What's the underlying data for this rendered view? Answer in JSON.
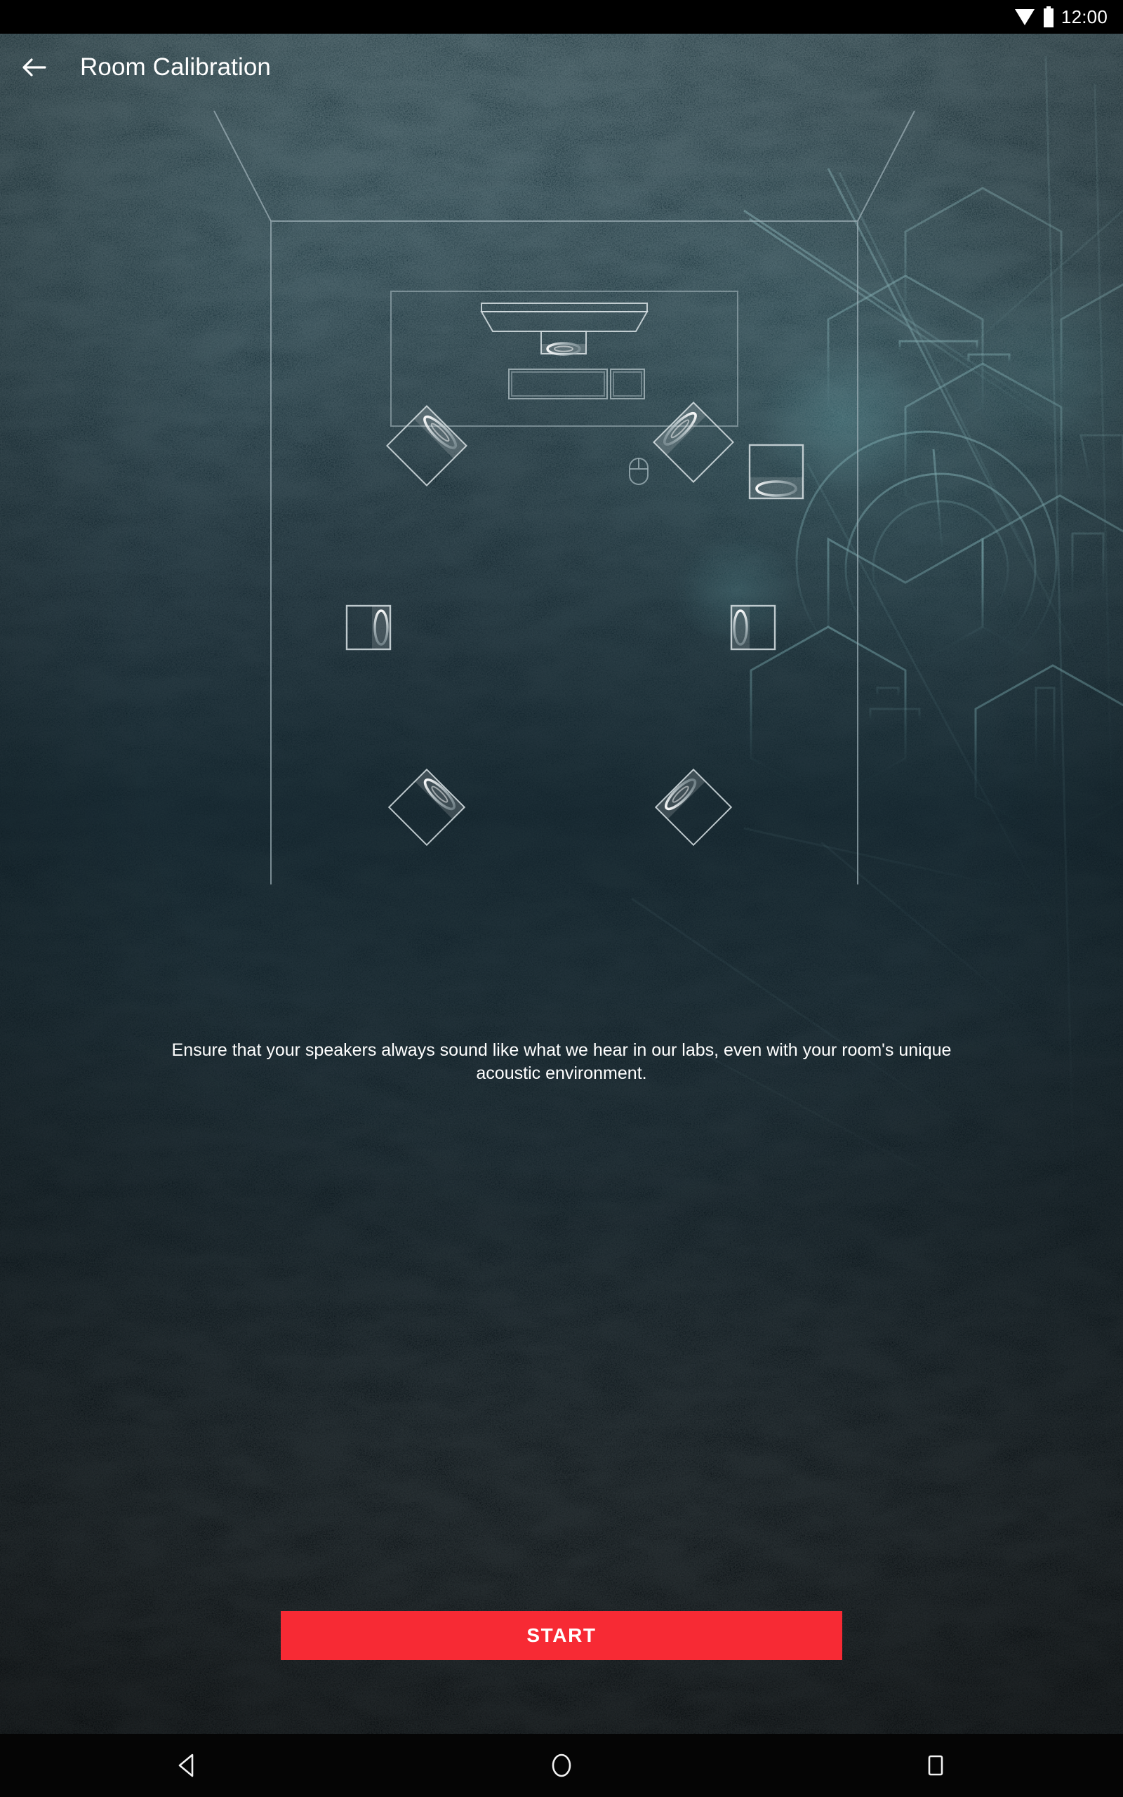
{
  "status_bar": {
    "clock": "12:00",
    "icons": [
      "wifi-icon",
      "battery-icon"
    ]
  },
  "app_bar": {
    "back_icon": "arrow-left-icon",
    "title": "Room Calibration"
  },
  "room_diagram": {
    "label": "room-speaker-layout-diagram",
    "devices": [
      {
        "id": "tv",
        "name": "television",
        "type": "tv"
      },
      {
        "id": "center-speaker",
        "name": "center-channel-speaker",
        "type": "speaker-center"
      },
      {
        "id": "av-receiver",
        "name": "av-receiver",
        "type": "cabinet"
      },
      {
        "id": "media-box",
        "name": "media-box",
        "type": "box"
      },
      {
        "id": "remote",
        "name": "remote-mouse",
        "type": "mouse"
      },
      {
        "id": "front-left-speaker",
        "name": "front-left-speaker",
        "type": "speaker-diamond"
      },
      {
        "id": "front-right-speaker",
        "name": "front-right-speaker",
        "type": "speaker-diamond"
      },
      {
        "id": "subwoofer",
        "name": "subwoofer",
        "type": "speaker-box"
      },
      {
        "id": "surround-left-speaker",
        "name": "surround-left-speaker",
        "type": "speaker-side"
      },
      {
        "id": "surround-right-speaker",
        "name": "surround-right-speaker",
        "type": "speaker-side"
      },
      {
        "id": "rear-left-speaker",
        "name": "rear-left-speaker",
        "type": "speaker-diamond"
      },
      {
        "id": "rear-right-speaker",
        "name": "rear-right-speaker",
        "type": "speaker-diamond"
      }
    ]
  },
  "description": {
    "text": "Ensure that your speakers always sound like what we hear in our labs, even with your room's unique acoustic environment."
  },
  "start_button": {
    "label": "START"
  },
  "nav_bar": {
    "back_label": "back-triangle-icon",
    "home_label": "home-circle-icon",
    "recents_label": "recents-square-icon"
  },
  "colors": {
    "accent": "#f72a34",
    "background_top": "#16333c",
    "background_bottom": "#050f15",
    "diagram_line": "#b9c6ca",
    "text": "#ffffff"
  }
}
